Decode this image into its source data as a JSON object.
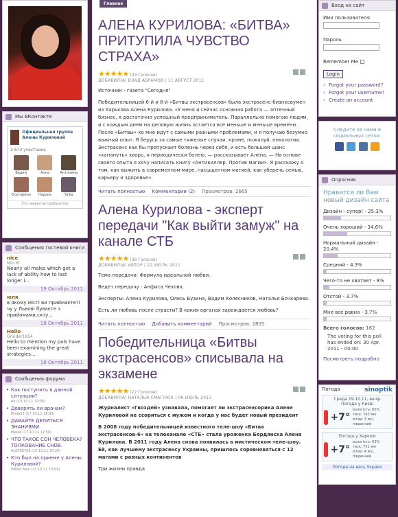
{
  "colors": {
    "accent": "#5a3a8a",
    "bg": "#4a2a4c",
    "star": "#f0a800",
    "poll_bar": "#c9b7d6"
  },
  "left": {
    "vk": {
      "title": "Мы ВКонтакте",
      "group": "Официальная группа Алены Куриловой",
      "count": "3 673 участника",
      "people": [
        "Вадим",
        "Анна",
        "Антонина",
        "Екатерина",
        "Наранє",
        "Yulka"
      ],
      "footer": "Это закрытое сообщество"
    },
    "guestbook": {
      "title": "Сообщения гостевой книги",
      "items": [
        {
          "who": "nice",
          "sub": "Mitchf",
          "text": "Nearly all males which get a lack of ability how to last longer i...",
          "date": "19 Октябрь 2011"
        },
        {
          "who": "юля",
          "sub": "",
          "text": "в якому місті ви приймаєте?і чу у Львові буваєте з прийомами.скту...",
          "date": "18 Октябрь 2011"
        },
        {
          "who": "Hello",
          "sub": "Grinder1954",
          "text": "Hello to mention my pals have been examining the great strategies...",
          "date": "18 Октябрь 2011"
        }
      ]
    },
    "forum": {
      "title": "Сообщения форума",
      "items": [
        {
          "t": "Как поступить в данной ситуации?",
          "m": "Ал (19.10.11 19:00)"
        },
        {
          "t": "Доверять ли врачам?",
          "m": "Инна23 (17.10.11 18:03)"
        },
        {
          "t": "ДАВАЙТЕ ДЕЛИТЬСЯ ЗНАНИЯМИ",
          "m": "Миша (17.10.11 12:56)"
        },
        {
          "t": "ЧТО ТАКОЕ СОН ЧЕЛОВЕКА? ТОЛКОВАНИЕ СНОВ.",
          "m": "ALEXSEY68 (15.10.11 20:20)"
        },
        {
          "t": "Кто был на приеме у Алены Куриловой?",
          "m": "Trener Max (13.10.11 13:09)"
        }
      ]
    }
  },
  "main": {
    "tab": "Главная",
    "articles": [
      {
        "title": "АЛЕНА КУРИЛОВА: «БИТВА» ПРИТУПИЛА ЧУВСТВО СТРАХА»",
        "votes": "(39 Голосов)",
        "meta": "ДОБАВИЛ(А) ВЛАД АБРАМОВ | 11 АВГУСТ 2011",
        "paras": [
          "Источник - газета \"Сегодня\"",
          "Победительницей 6-й и 8-й «Битвы экстрасенсов» была экстрасенс-бизнесвумен из Харькова Алена Курилова. «У меня и сейчас основная работа — аптечный бизнес, я достаточно успешный предприниматель. Параллельно помогаю людям, и с каждым днем на деловую жизнь остается все меньше и меньше времени. После «Битвы» ко мне идут с самыми разными проблемами, и я получаю безумно важный опыт. Я берусь за самые тяжелые случаи, кроме, пожалуй, онкологии. Экстрасенс как бы пропускает болезнь через себя, и есть большой шанс «хапануть» хворь, я периодически болею, — рассказывает Алена. — На основе своего опыта я хочу написать книгу «Антикиллер. Против магии». Я расскажу о том, как выжить в современном мире, насыщенном магией, как уберечь семью, карьеру и здоровье»."
        ],
        "more": "Читать полностью",
        "comments": "Комментарии (2)",
        "views": "Просмотров: 2665"
      },
      {
        "title": "Алена Курилова - эксперт передачи \"Как выйти замуж\" на канале СТБ",
        "votes": "(38 Голосов)",
        "meta": "ДОБАВИЛ(А) АВТОР | 22 ИЮЛЬ 2011",
        "paras": [
          "Тема передачи: Формула идеальной любви.",
          "Ведет передачу - Анфиса Чехова.",
          "Эксперты: Алена Курилова, Олесь Бузина, Вадим Колесников, Наталья Бочкарева.",
          "Есть ли любовь после страсти? В каких органах зарождается любовь?"
        ],
        "more": "Читать полностью",
        "comments": "Добавить комментарий",
        "views": "Просмотров: 2805"
      },
      {
        "title": "Победительница «Битвы экстрасенсов» списывала на экзамене",
        "votes": "(22 Голосов)",
        "meta": "ДОБАВИЛ(А) НАТАЛЬЯ СМАГЛЮК | 06 ИЮЛЬ 2011",
        "paras": [
          "Журналист «Гвоздей» узнавала, помогает ли экстрасенсорика Алене Куриловой не ссориться с мужем и когда у нас будет новый президент",
          "В 2008 году победительницей известного теле-шоу «Битва экстрасенсов-6» на телеканале «СТБ» стала уроженка Бердянска Алена Курилова. В 2011 году Алена снова появилась в мистическом теле-шоу. Ей, как лучшему экстрасенсу Украины, пришлось соревноваться с 12 магами с разных континентов",
          "Три жизни правда"
        ]
      }
    ]
  },
  "right": {
    "login": {
      "title": "Вход на сайт",
      "user_label": "Имя пользователя",
      "pass_label": "Пароль",
      "remember": "Remember Me",
      "button": "Login",
      "links": [
        "Forgot your password?",
        "Forgot your username?",
        "Create an account"
      ]
    },
    "social": {
      "text": "Следите за нами в социальных сетях:"
    },
    "poll": {
      "title": "Опросник",
      "question": "Нравится ли Вам новый дизайн сайта",
      "options": [
        {
          "label": "Дизайн - супер! - 25.3%",
          "pct": 25.3
        },
        {
          "label": "Очень хороший - 34.6%",
          "pct": 34.6
        },
        {
          "label": "Нормальный дизайн - 20.4%",
          "pct": 20.4
        },
        {
          "label": "Средний - 4.3%",
          "pct": 4.3
        },
        {
          "label": "Чего-то не хватает - 8%",
          "pct": 8
        },
        {
          "label": "Отстой - 3.7%",
          "pct": 3.7
        },
        {
          "label": "Мне все равно - 3.7%",
          "pct": 3.7
        }
      ],
      "total_label": "Всего голосов:",
      "total": "162",
      "ended": "The voting for this poll has ended on: 30 Apr. 2011 - 00:00",
      "results": "Посмотреть подробно"
    },
    "weather": {
      "label": "Погода",
      "brand": "sinoptik",
      "cities": [
        {
          "date": "Среда 19.10.11, вечір",
          "city": "Погода у Києві",
          "temp": "+7°",
          "w1": "вологість: 65%",
          "w2": "тиск: 743 мм",
          "w3": "вітер: 3 м/с, південний"
        },
        {
          "date": "",
          "city": "Погода у Харкові",
          "temp": "+7°",
          "w1": "вологість: 63%",
          "w2": "тиск: 751 мм",
          "w3": "вітер: 4 м/с, південний"
        }
      ],
      "note": "Погода на весь Україні"
    }
  }
}
